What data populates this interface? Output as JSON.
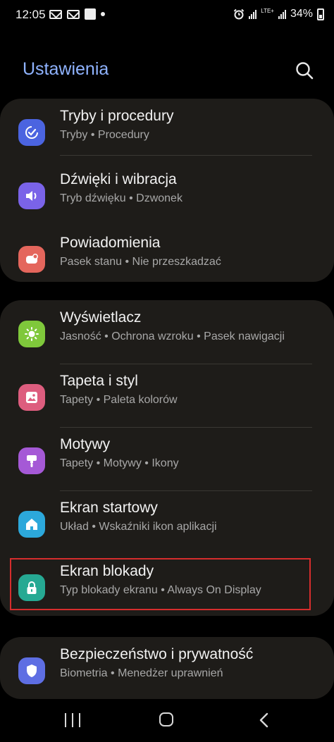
{
  "status_bar": {
    "time": "12:05",
    "left_icons": [
      "mail-icon",
      "mail-icon",
      "app-icon",
      "dot-icon"
    ],
    "right_icons": [
      "alarm-icon",
      "signal-icon",
      "lte-icon",
      "signal-icon"
    ],
    "lte_label": "LTE+",
    "battery": "34%"
  },
  "header": {
    "title": "Ustawienia",
    "search_icon": "search-icon"
  },
  "colors": {
    "title": "#8fb3ff",
    "card": "#1e1c19",
    "highlight": "#d62d2d"
  },
  "groups": [
    {
      "items": [
        {
          "title": "Tryby i procedury",
          "subtitle": "Tryby  •  Procedury",
          "icon": "modes-check-icon",
          "color": "#4b64e0"
        },
        {
          "title": "Dźwięki i wibracja",
          "subtitle": "Tryb dźwięku  •  Dzwonek",
          "icon": "speaker-icon",
          "color": "#7a63e8"
        },
        {
          "title": "Powiadomienia",
          "subtitle": "Pasek stanu  •  Nie przeszkadzać",
          "icon": "notification-icon",
          "color": "#e4665c"
        }
      ]
    },
    {
      "items": [
        {
          "title": "Wyświetlacz",
          "subtitle": "Jasność  •  Ochrona wzroku  •  Pasek nawigacji",
          "icon": "brightness-icon",
          "color": "#7fc83b"
        },
        {
          "title": "Tapeta i styl",
          "subtitle": "Tapety  •  Paleta kolorów",
          "icon": "wallpaper-icon",
          "color": "#dd5d7e"
        },
        {
          "title": "Motywy",
          "subtitle": "Tapety  •  Motywy  •  Ikony",
          "icon": "brush-icon",
          "color": "#a559d6"
        },
        {
          "title": "Ekran startowy",
          "subtitle": "Układ  •  Wskaźniki ikon aplikacji",
          "icon": "home-icon",
          "color": "#2ca8db"
        },
        {
          "title": "Ekran blokady",
          "subtitle": "Typ blokady ekranu  •  Always On Display",
          "icon": "lock-icon",
          "color": "#26a993"
        }
      ]
    },
    {
      "items": [
        {
          "title": "Bezpieczeństwo i prywatność",
          "subtitle": "Biometria  •  Menedżer uprawnień",
          "icon": "shield-icon",
          "color": "#5e6ee3"
        }
      ]
    }
  ],
  "nav": {
    "recent": "recent-apps-icon",
    "home": "home-button-icon",
    "back": "back-icon"
  }
}
